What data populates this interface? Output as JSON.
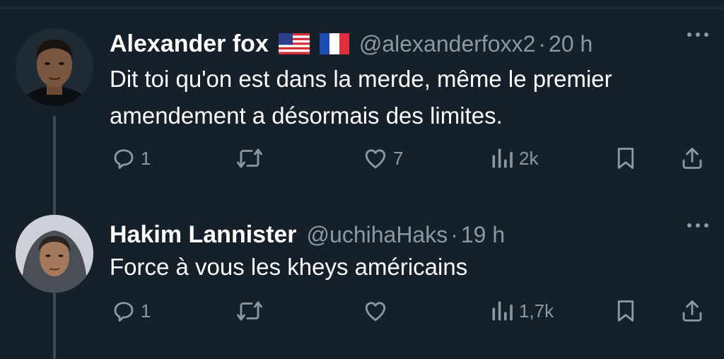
{
  "tweets": [
    {
      "display_name": "Alexander fox",
      "flags": [
        "us-flag",
        "fr-flag"
      ],
      "handle": "@alexanderfoxx2",
      "separator": "·",
      "time": "20 h",
      "text_lines": [
        "Dit toi qu'on est dans la merde, même le premier",
        "amendement a désormais des limites."
      ],
      "replies": "1",
      "retweets": "",
      "likes": "7",
      "views": "2k"
    },
    {
      "display_name": "Hakim Lannister",
      "handle": "@uchihaHaks",
      "separator": "·",
      "time": "19 h",
      "text_lines": [
        "Force à vous les kheys américains"
      ],
      "replies": "1",
      "retweets": "",
      "likes": "",
      "views": "1,7k"
    }
  ],
  "icons": {
    "reply": "reply-icon",
    "retweet": "retweet-icon",
    "like": "heart-icon",
    "views": "views-icon",
    "bookmark": "bookmark-icon",
    "share": "share-icon",
    "more": "more-icon"
  },
  "colors": {
    "background": "#15202b",
    "text": "#ffffff",
    "secondary": "#8b98a5",
    "thread_line": "#3d4a56"
  }
}
